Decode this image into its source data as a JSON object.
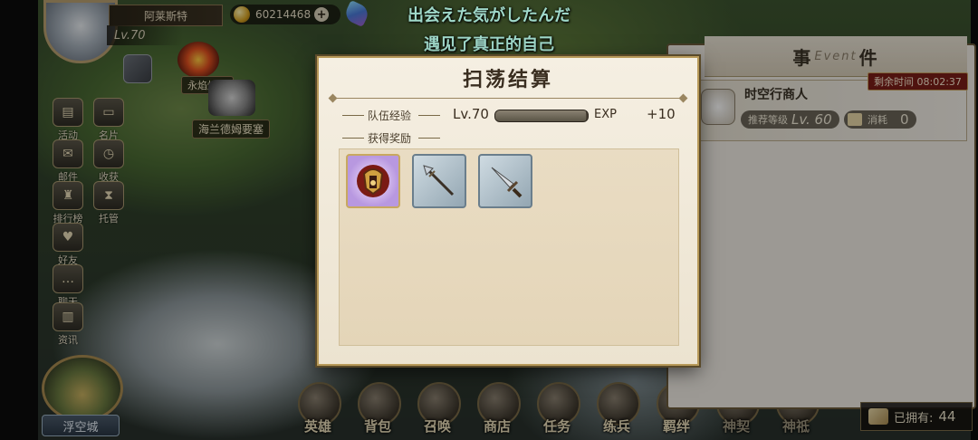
{
  "player": {
    "name": "阿莱斯特",
    "level": "Lv.70",
    "coins": "60214468"
  },
  "subtitles": {
    "japanese": "出会えた気がしたんだ",
    "chinese": "遇见了真正的自己"
  },
  "map": {
    "markers": [
      "永焰熔炉",
      "海兰德姆要塞"
    ]
  },
  "left_menu": [
    {
      "label": "活动",
      "icon": "scroll-icon"
    },
    {
      "label": "名片",
      "icon": "card-icon"
    },
    {
      "label": "邮件",
      "icon": "mail-icon"
    },
    {
      "label": "收获",
      "icon": "clock-icon"
    },
    {
      "label": "排行榜",
      "icon": "trophy-icon"
    },
    {
      "label": "托管",
      "icon": "hourglass-icon"
    },
    {
      "label": "好友",
      "icon": "heart-icon"
    },
    {
      "label": "聊天",
      "icon": "chat-icon"
    },
    {
      "label": "资讯",
      "icon": "book-icon"
    }
  ],
  "floating_city": "浮空城",
  "bottom_nav": [
    {
      "label": "英雄",
      "icon": "helmet-icon",
      "dimmed": false
    },
    {
      "label": "背包",
      "icon": "bag-icon",
      "dimmed": false
    },
    {
      "label": "召唤",
      "icon": "summon-icon",
      "dimmed": false
    },
    {
      "label": "商店",
      "icon": "shop-icon",
      "dimmed": false
    },
    {
      "label": "任务",
      "icon": "quest-icon",
      "dimmed": false
    },
    {
      "label": "练兵",
      "icon": "training-icon",
      "dimmed": false
    },
    {
      "label": "羁绊",
      "icon": "bond-icon",
      "dimmed": false
    },
    {
      "label": "神契",
      "icon": "pact-icon",
      "dimmed": true
    },
    {
      "label": "神祗",
      "icon": "deity-icon",
      "dimmed": true
    }
  ],
  "event_panel": {
    "title_left": "事",
    "title_en": "Event",
    "title_right": "件",
    "timer": "剩余时间 08:02:37",
    "merchant": {
      "name": "时空行商人",
      "recommend_label": "推荐等级",
      "recommend_level": "Lv. 60",
      "cost_label": "消耗",
      "cost_value": "0"
    },
    "owned_label": "已拥有:",
    "owned_value": "44"
  },
  "dialog": {
    "title": "扫荡结算",
    "team_exp_label": "队伍经验",
    "level": "Lv.70",
    "exp_label": "EXP",
    "exp_gain": "+10",
    "exp_progress": 0.98,
    "rewards_label": "获得奖励",
    "rewards": [
      {
        "icon": "helmet-emblem-icon",
        "rarity": "epic"
      },
      {
        "icon": "spear-icon",
        "rarity": "common"
      },
      {
        "icon": "sword-icon",
        "rarity": "common"
      }
    ]
  }
}
